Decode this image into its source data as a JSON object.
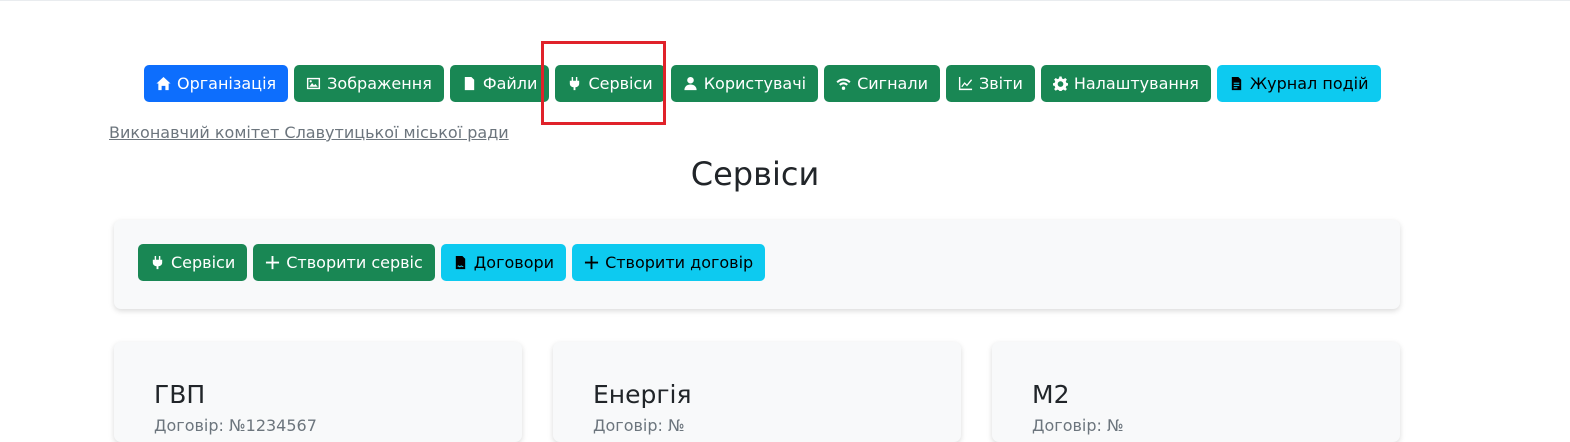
{
  "nav": [
    {
      "label": "Організація",
      "icon": "home-icon",
      "style": "primary"
    },
    {
      "label": "Зображення",
      "icon": "image-icon",
      "style": "success"
    },
    {
      "label": "Файли",
      "icon": "file-icon",
      "style": "success"
    },
    {
      "label": "Сервіси",
      "icon": "plug-icon",
      "style": "success"
    },
    {
      "label": "Користувачі",
      "icon": "user-icon",
      "style": "success"
    },
    {
      "label": "Сигнали",
      "icon": "wifi-icon",
      "style": "success"
    },
    {
      "label": "Звіти",
      "icon": "chart-line-icon",
      "style": "success"
    },
    {
      "label": "Налаштування",
      "icon": "gear-icon",
      "style": "success"
    },
    {
      "label": "Журнал подій",
      "icon": "file-text-icon",
      "style": "info"
    }
  ],
  "org_link": "Виконавчий комітет Славутицької міської ради",
  "page_title": "Сервіси",
  "toolbar": [
    {
      "label": "Сервіси",
      "icon": "plug-icon",
      "style": "success"
    },
    {
      "label": "Створити сервіс",
      "icon": "plus-icon",
      "style": "success"
    },
    {
      "label": "Договори",
      "icon": "file-contract-icon",
      "style": "info"
    },
    {
      "label": "Створити договір",
      "icon": "plus-icon",
      "style": "info"
    }
  ],
  "services": [
    {
      "name": "ГВП",
      "contract": "Договір: №1234567"
    },
    {
      "name": "Енергія",
      "contract": "Договір: №"
    },
    {
      "name": "М2",
      "contract": "Договір: №"
    }
  ],
  "colors": {
    "primary": "#0d6efd",
    "success": "#198754",
    "info": "#0dcaf0",
    "highlight": "#e0222a"
  }
}
